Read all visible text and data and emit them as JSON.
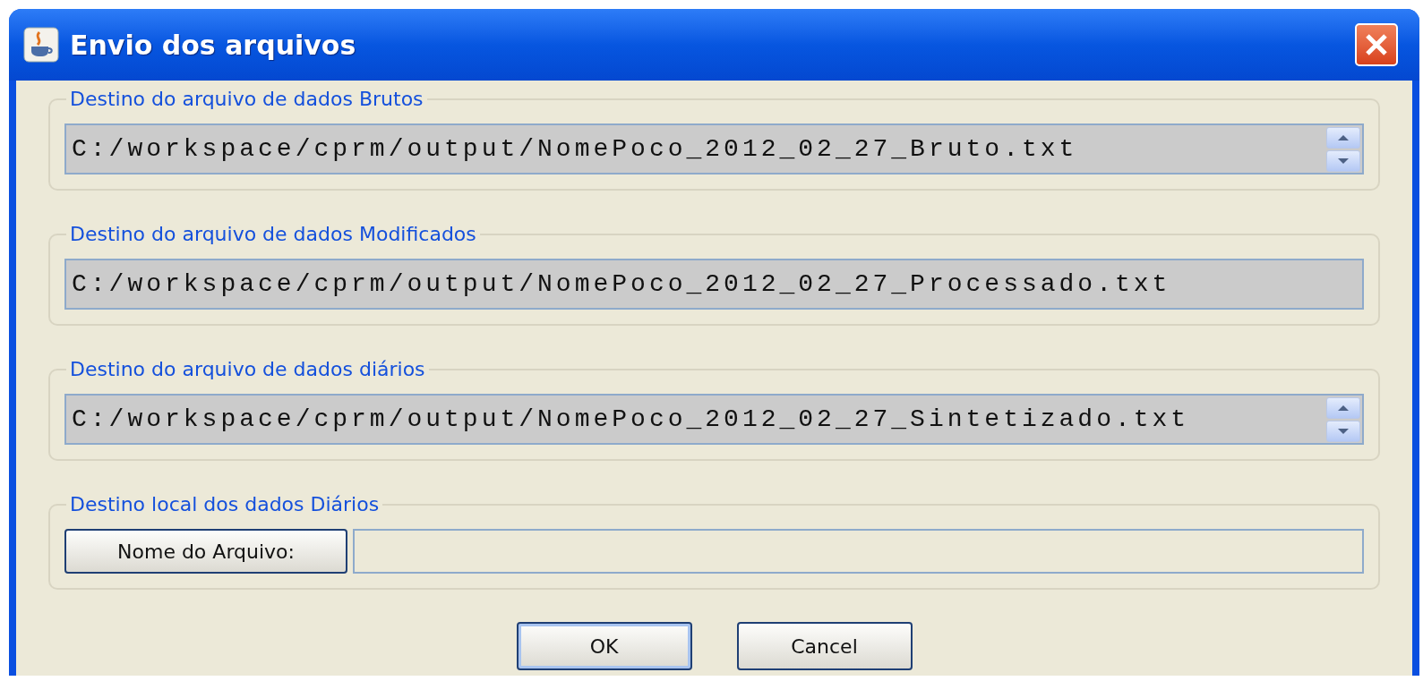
{
  "window": {
    "title": "Envio dos arquivos"
  },
  "groups": [
    {
      "kind": "path",
      "legend": "Destino do arquivo de dados Brutos",
      "value": "C:/workspace/cprm/output/NomePoco_2012_02_27_Bruto.txt",
      "scrollbar": true
    },
    {
      "kind": "path",
      "legend": "Destino do arquivo de dados Modificados",
      "value": "C:/workspace/cprm/output/NomePoco_2012_02_27_Processado.txt",
      "scrollbar": false
    },
    {
      "kind": "path",
      "legend": "Destino do arquivo de dados diários",
      "value": "C:/workspace/cprm/output/NomePoco_2012_02_27_Sintetizado.txt",
      "scrollbar": true
    },
    {
      "kind": "chooser",
      "legend": "Destino local dos dados Diários",
      "button": "Nome do Arquivo:"
    }
  ],
  "buttons": [
    {
      "label": "OK",
      "selected": true
    },
    {
      "label": "Cancel",
      "selected": false
    }
  ]
}
